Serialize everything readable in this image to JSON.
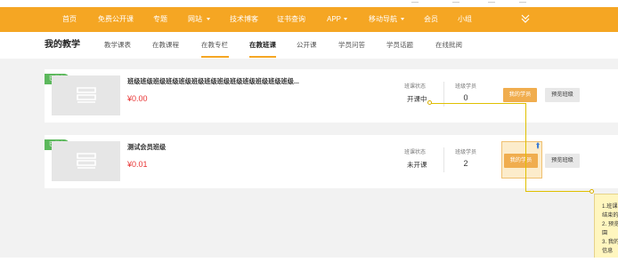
{
  "top_nav": {
    "items": [
      {
        "label": "首页",
        "caret": false
      },
      {
        "label": "免费公开课",
        "caret": false
      },
      {
        "label": "专题",
        "caret": false
      },
      {
        "label": "网站",
        "caret": true
      },
      {
        "label": "技术博客",
        "caret": false
      },
      {
        "label": "证书查询",
        "caret": false
      },
      {
        "label": "APP",
        "caret": true
      },
      {
        "label": "移动导航",
        "caret": true
      },
      {
        "label": "会员",
        "caret": false
      },
      {
        "label": "小组",
        "caret": false
      }
    ],
    "expand_icon": "double-chevron-down-icon"
  },
  "sub_nav": {
    "title": "我的教学",
    "tabs": [
      {
        "label": "教学课表",
        "active": false
      },
      {
        "label": "在教课程",
        "active": false
      },
      {
        "label": "在教专栏",
        "active": false
      },
      {
        "label": "在教班课",
        "active": true
      },
      {
        "label": "公开课",
        "active": false
      },
      {
        "label": "学员问答",
        "active": false
      },
      {
        "label": "学员话题",
        "active": false
      },
      {
        "label": "在线批阅",
        "active": false
      }
    ]
  },
  "classes": [
    {
      "badge": "已发布",
      "title": "班级班级班级班级班级班级班级班级班级班级班级班级班级...",
      "price": "¥0.00",
      "status_label": "班课状态",
      "status_value": "开课中",
      "students_label": "班级学员",
      "students_value": "0",
      "primary_button": "我的学员",
      "secondary_button": "预览班级"
    },
    {
      "badge": "已发布",
      "title": "测试会员班级",
      "price": "¥0.01",
      "status_label": "班课状态",
      "status_value": "未开课",
      "students_label": "班级学员",
      "students_value": "2",
      "primary_button": "我的学员",
      "secondary_button": "预览班级"
    }
  ],
  "annotation": {
    "lines": [
      "1.班课",
      "结束的",
      "2. 预览",
      "園",
      "3. 我的",
      "信息"
    ]
  },
  "colors": {
    "brand": "#f5a623",
    "badge": "#5cb85c",
    "price": "#e83535",
    "annotation_bg": "#fff6bf",
    "connector": "#e0c000"
  }
}
